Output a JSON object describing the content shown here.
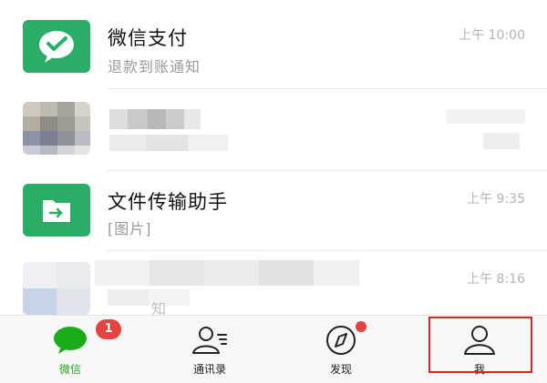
{
  "chats": [
    {
      "title": "微信支付",
      "subtitle": "退款到账通知",
      "time": "上午 10:00",
      "icon": "wechat-pay-icon"
    },
    {
      "title": "",
      "subtitle": "",
      "time": "",
      "icon": "blurred-avatar"
    },
    {
      "title": "文件传输助手",
      "subtitle": "[图片]",
      "time": "上午 9:35",
      "icon": "file-transfer-icon"
    },
    {
      "title": "",
      "subtitle": "知",
      "time": "上午 8:16",
      "icon": "blurred-avatar"
    }
  ],
  "tabbar": {
    "tabs": [
      {
        "label": "微信",
        "icon": "chat-bubble-icon",
        "badge": "1",
        "active": true
      },
      {
        "label": "通讯录",
        "icon": "contacts-icon"
      },
      {
        "label": "发现",
        "icon": "compass-icon",
        "dot": true
      },
      {
        "label": "我",
        "icon": "person-icon",
        "highlighted": true
      }
    ]
  },
  "colors": {
    "brand_green": "#2aae67",
    "active_label": "#1aad19",
    "badge_red": "#e64340",
    "highlight_red": "#e0201c"
  }
}
